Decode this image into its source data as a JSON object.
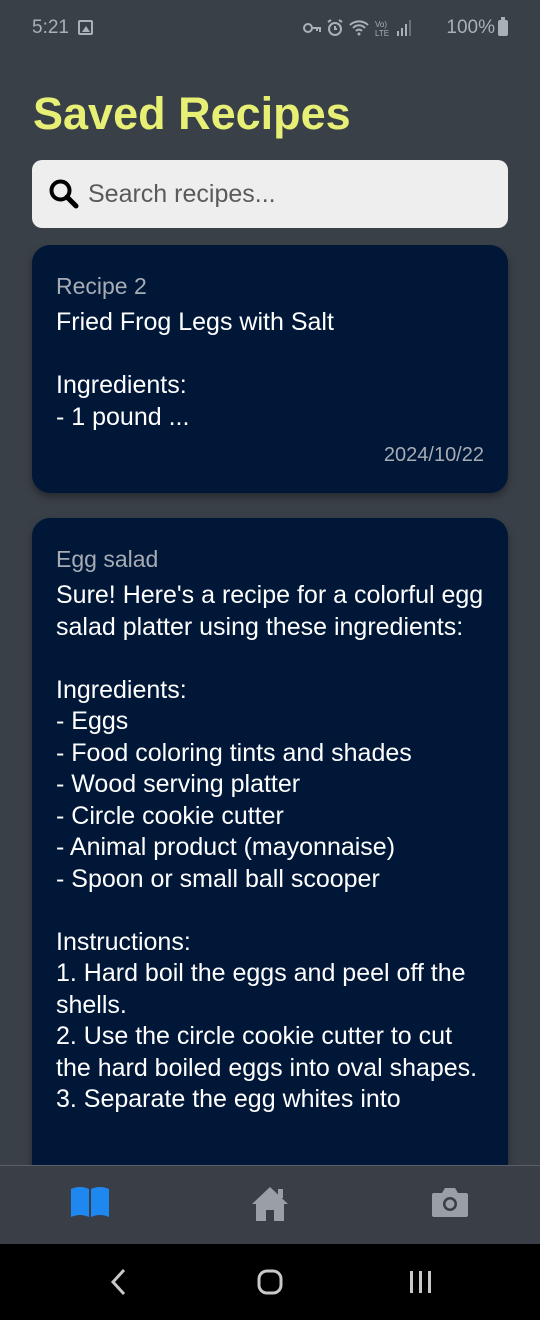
{
  "status_bar": {
    "time": "5:21",
    "battery": "100%"
  },
  "header": {
    "title": "Saved Recipes"
  },
  "search": {
    "placeholder": "Search recipes..."
  },
  "recipes": [
    {
      "title": "Recipe 2",
      "body": "Fried Frog Legs with Salt\n\nIngredients:\n- 1 pound ...",
      "date": "2024/10/22"
    },
    {
      "title": "Egg salad",
      "body": "Sure! Here's a recipe for a colorful egg salad platter using these ingredients:\n\nIngredients:\n- Eggs\n- Food coloring tints and shades\n- Wood serving platter\n- Circle cookie cutter\n- Animal product (mayonnaise)\n- Spoon or small ball scooper\n\nInstructions:\n1. Hard boil the eggs and peel off the shells.\n2. Use the circle cookie cutter to cut the hard boiled eggs into oval shapes.\n3. Separate the egg whites into"
    }
  ],
  "bottom_nav": {
    "items": [
      {
        "icon": "book-icon",
        "active": true
      },
      {
        "icon": "home-icon",
        "active": false
      },
      {
        "icon": "camera-icon",
        "active": false
      }
    ],
    "active_color": "#1e88f0",
    "inactive_color": "#9a9ea5"
  },
  "colors": {
    "background": "#3a4048",
    "title": "#e7f074",
    "card": "#001738"
  }
}
